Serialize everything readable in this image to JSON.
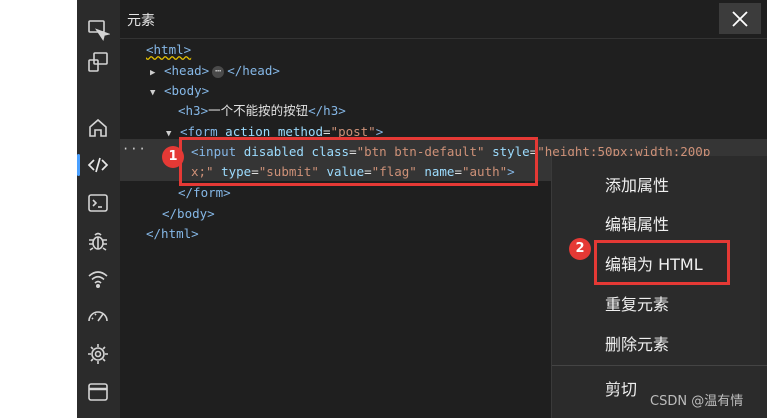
{
  "panel": {
    "title": "元素"
  },
  "tree": {
    "html_open": "<html>",
    "head_open": "<head>",
    "head_ellipsis": "⋯",
    "head_close": "</head>",
    "body_open": "<body>",
    "h3_open": "<h3>",
    "h3_text": "一个不能按的按钮",
    "h3_close": "</h3>",
    "form_open_tag": "<form",
    "form_attr_action": "action",
    "form_attr_method": "method",
    "form_eq": "=",
    "form_method_value": "\"post\"",
    "form_close_bracket": ">",
    "input_tag": "<input",
    "input_attr_disabled": "disabled",
    "input_attr_class": "class",
    "input_class_value": "\"btn btn-default\"",
    "input_attr_style": "style",
    "input_style_value_1": "\"height:50px;width:200p",
    "input_style_value_2": "x;\"",
    "input_attr_type": "type",
    "input_type_value": "\"submit\"",
    "input_attr_value": "value",
    "input_value_value": "\"flag\"",
    "input_attr_name": "name",
    "input_name_value": "\"auth\"",
    "input_end": ">",
    "form_close": "</form>",
    "body_close": "</body>",
    "html_close": "</html>",
    "selected_dots": "···"
  },
  "badges": {
    "one": "1",
    "two": "2"
  },
  "context_menu": {
    "items": [
      "添加属性",
      "编辑属性",
      "编辑为 HTML",
      "重复元素",
      "删除元素",
      "剪切"
    ]
  },
  "watermark": "CSDN @温有情",
  "colors": {
    "highlight": "#e53935",
    "accent": "#4aa0ff",
    "background": "#1f1f1f"
  },
  "icons": [
    "device-emulation-icon",
    "dock-icon",
    "home-icon",
    "elements-code-icon",
    "console-icon",
    "debugger-bug-icon",
    "network-wifi-icon",
    "performance-gauge-icon",
    "settings-chip-icon",
    "application-window-icon",
    "close-icon"
  ]
}
